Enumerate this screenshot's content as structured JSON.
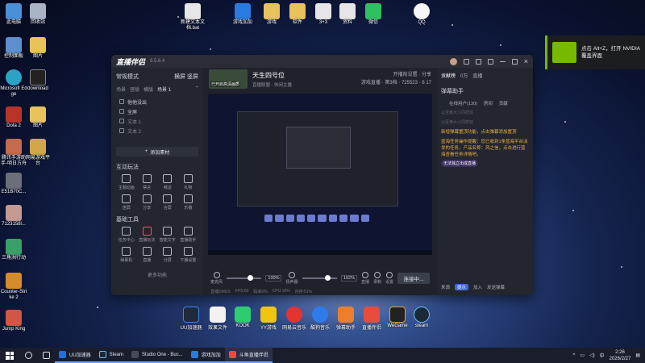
{
  "desktop_icons": [
    {
      "label": "此电脑",
      "color": "#4a90d9"
    },
    {
      "label": "回收站",
      "color": "#a9b4c6"
    },
    {
      "label": "控制面板",
      "color": "#5d8fd0"
    },
    {
      "label": "图片",
      "color": "#e8c35b"
    },
    {
      "label": "Microsoft Edge",
      "color": "#2ba3c4"
    },
    {
      "label": "download",
      "color": "#222222"
    },
    {
      "label": "Dota 2",
      "color": "#b8342b"
    },
    {
      "label": "图片",
      "color": "#e8c35b"
    },
    {
      "label": "腾讯手游助手-明日方舟",
      "color": "#c46a4e"
    },
    {
      "label": "网易游戏平台",
      "color": "#d4a64a"
    },
    {
      "label": "E51B70C...",
      "color": "#6b6f7a"
    },
    {
      "label": "7123158l...",
      "color": "#c49a92"
    },
    {
      "label": "三角洲行动",
      "color": "#3aa06a"
    },
    {
      "label": "Counter-Strike 2",
      "color": "#d58a2b"
    },
    {
      "label": "Jump King",
      "color": "#d05646"
    }
  ],
  "top_icons": [
    {
      "label": "新建文本文档.bat",
      "color": "#e6e6e6"
    },
    {
      "label": "游戏加加",
      "color": "#2a7be0"
    },
    {
      "label": "游戏",
      "color": "#e8c35b"
    },
    {
      "label": "软件",
      "color": "#e8c35b"
    },
    {
      "label": "3+3",
      "color": "#e6e6e6"
    },
    {
      "label": "资料",
      "color": "#e6e6e6"
    },
    {
      "label": "微信",
      "color": "#2dc160"
    },
    {
      "label": "QQ",
      "color": "#f5f5f5"
    }
  ],
  "notification": {
    "text": "点击 Alt+Z，打开 NVIDIA 覆盖界面"
  },
  "window": {
    "brand": "直播伴侣",
    "version": "6.5.6.4",
    "left": {
      "mode": "常规模式",
      "mode_right": "横屏",
      "mode_right2": "竖屏",
      "scene_tabs": [
        "场景",
        "竖版",
        "横版",
        "场景 1"
      ],
      "items": [
        "他他没出",
        "全屏",
        "文本 1",
        "文本 2"
      ],
      "add": "添加素材",
      "interact_title": "互动玩法",
      "interact": [
        "主题动画",
        "禁言",
        "喊话",
        "礼物",
        "连屏",
        "分享",
        "合屏",
        "乐播"
      ],
      "tools_title": "基础工具",
      "tools": [
        "任务中心",
        "直播玩法",
        "智能文字",
        "直播助手",
        "弹幕机",
        "直播",
        "分屏",
        "下播设置"
      ],
      "more": "更多功能"
    },
    "room": {
      "title": "天生四号位",
      "subtitle": "直播联盟 - 休闲主播",
      "thumb_label": "已开启高清画质",
      "stats1": "开播前设置",
      "stats2": "分享",
      "stats3": "游戏直播 · 第3档",
      "views": "725523",
      "fans": "6 17"
    },
    "audio": {
      "mic_label": "麦克风",
      "mic_pct": "100%",
      "speaker_label": "扬声器",
      "speaker_pct": "102%",
      "icons": [
        "直播",
        "录制",
        "设置"
      ],
      "connect": "连接中...",
      "status": [
        "直播DMUS",
        "FPS:60",
        "码率0%",
        "CPU:18%",
        "内存:51%"
      ]
    },
    "right": {
      "tabs": [
        "贡献榜",
        "0万",
        "直播"
      ],
      "title": "弹幕助手",
      "sub_tabs": [
        "在线用户(130)",
        "房间",
        "贡献"
      ],
      "dim1": "以至某大小同样双",
      "dim2": "以至某大小同样双",
      "msg1": "新增弹幕置顶功能，点击弹幕添加置顶",
      "msg2": "蓝海任务操作提醒：您已收到1条蓝海平台派发的任务，产品名称：风之信，点击进行蓝海查看任务详情吧。",
      "pill": "无法独立出成直播",
      "foot": [
        "来源",
        "提示",
        "加入",
        "发送弹幕"
      ]
    }
  },
  "dock_icons": [
    {
      "label": "UU加速器",
      "color": "#1f2a3a"
    },
    {
      "label": "效果文件",
      "color": "#f2f2f2"
    },
    {
      "label": "KOOK",
      "color": "#2ecc71"
    },
    {
      "label": "YY游戏",
      "color": "#f1c40f"
    },
    {
      "label": "网易云音乐",
      "color": "#e3342f"
    },
    {
      "label": "酷狗音乐",
      "color": "#2f7bea"
    },
    {
      "label": "弹幕助手",
      "color": "#ec7e2c"
    },
    {
      "label": "直播伴侣",
      "color": "#e74c3c"
    },
    {
      "label": "WeGame",
      "color": "#222222"
    },
    {
      "label": "steam",
      "color": "#1b2838"
    }
  ],
  "taskbar": {
    "tasks": [
      {
        "label": "UU加速器",
        "color": "#1f6fe0"
      },
      {
        "label": "Steam",
        "color": "#1b2838"
      },
      {
        "label": "Studio One - Buc...",
        "color": "#444a5a"
      },
      {
        "label": "游戏加加",
        "color": "#2a7be0"
      },
      {
        "label": "斗鱼直播伴侣",
        "color": "#e74c3c"
      }
    ],
    "lang": "中",
    "time": "2:26",
    "date": "2026/2/27"
  }
}
